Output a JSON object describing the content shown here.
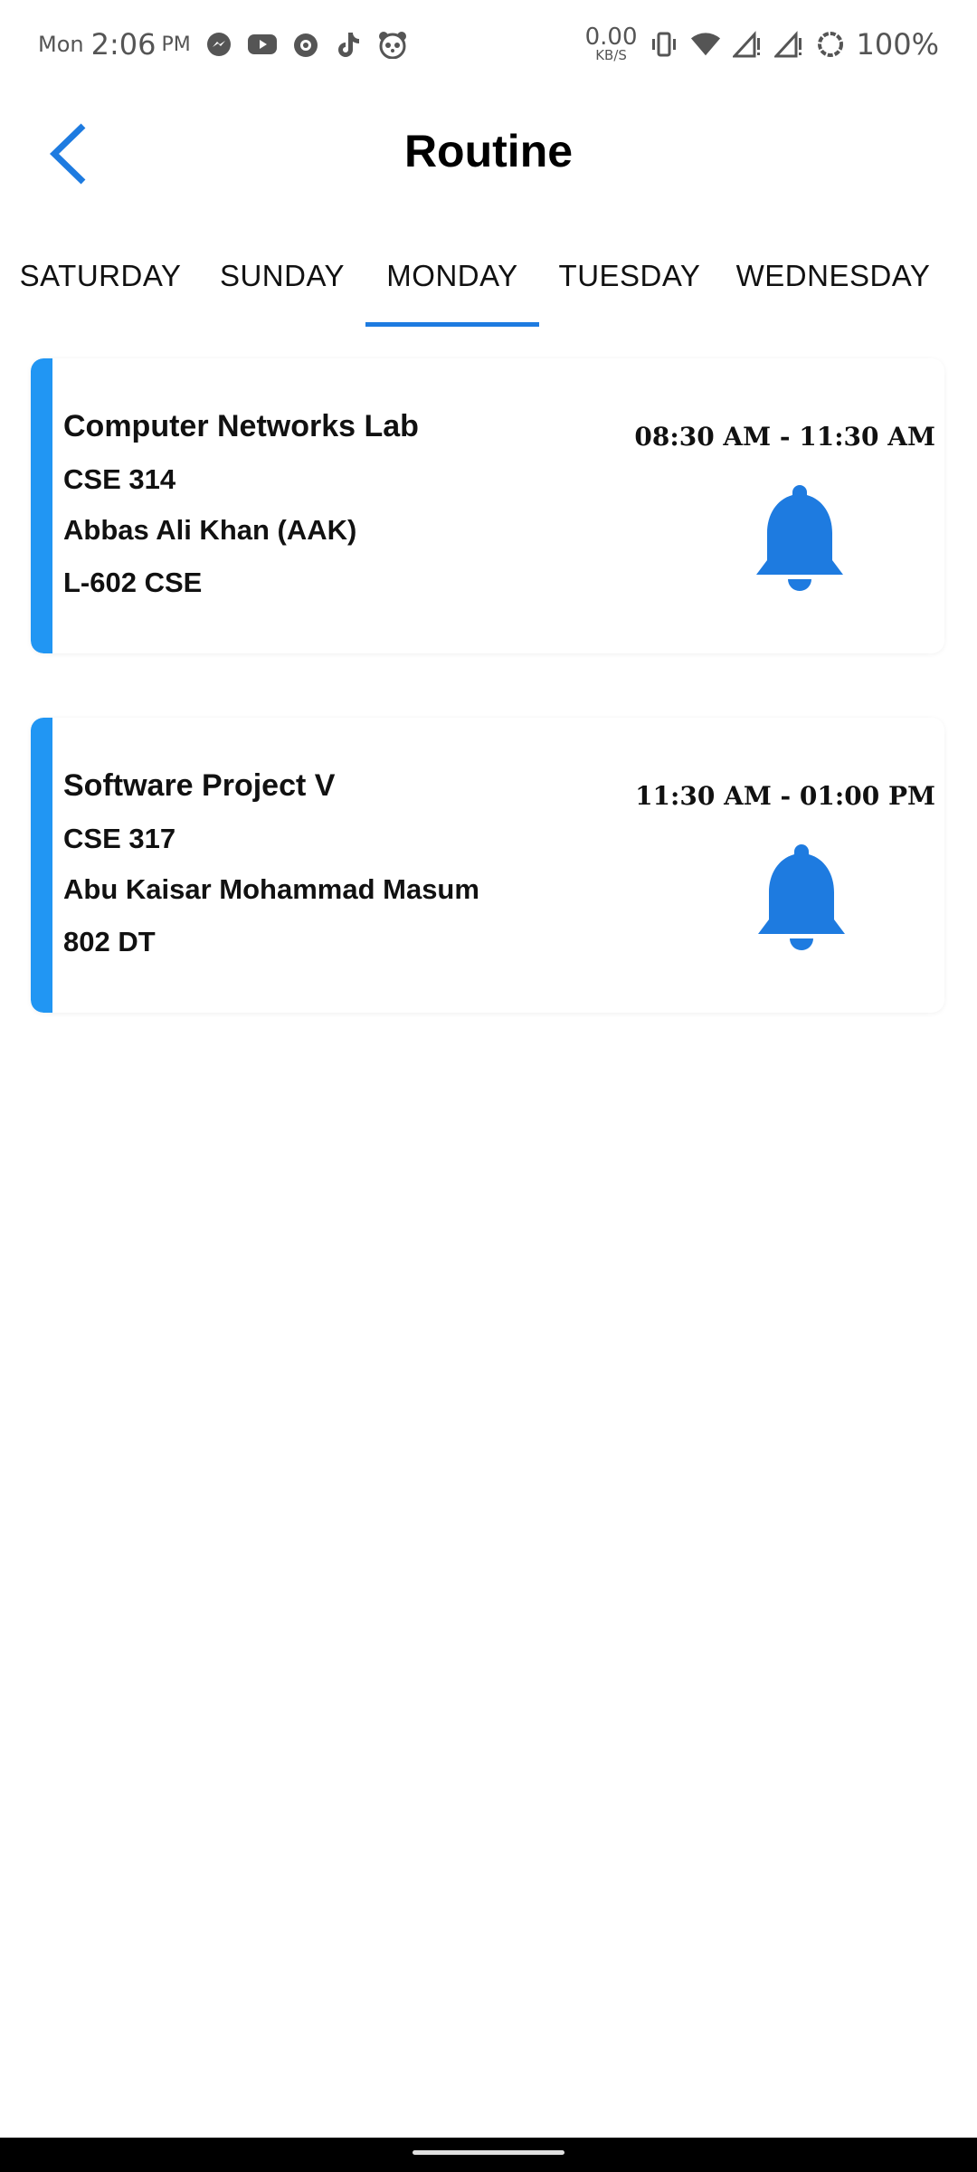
{
  "status_bar": {
    "day": "Mon",
    "time": "2:06",
    "ampm": "PM",
    "net_speed_value": "0.00",
    "net_speed_unit": "KB/S",
    "battery": "100%",
    "icons": [
      "messenger-icon",
      "youtube-icon",
      "app-icon",
      "tiktok-icon",
      "panda-icon",
      "vibrate-icon",
      "wifi-icon",
      "signal-icon",
      "signal-icon-2",
      "battery-saver-icon"
    ]
  },
  "header": {
    "title": "Routine",
    "back_icon": "chevron-left-icon"
  },
  "tabs": [
    {
      "label": "SATURDAY",
      "selected": false
    },
    {
      "label": "SUNDAY",
      "selected": false
    },
    {
      "label": "MONDAY",
      "selected": true
    },
    {
      "label": "TUESDAY",
      "selected": false
    },
    {
      "label": "WEDNESDAY",
      "selected": false
    }
  ],
  "classes": [
    {
      "title": "Computer Networks Lab",
      "code": "CSE 314",
      "instructor": "Abbas Ali Khan (AAK)",
      "room": "L-602 CSE",
      "time": "08:30 AM - 11:30 AM",
      "icon": "bell-icon"
    },
    {
      "title": "Software Project V",
      "code": "CSE 317",
      "instructor": "Abu Kaisar Mohammad Masum",
      "room": "802 DT",
      "time": "11:30 AM - 01:00 PM",
      "icon": "bell-icon"
    }
  ],
  "colors": {
    "accent": "#2196f3",
    "primary": "#1e7be0"
  }
}
